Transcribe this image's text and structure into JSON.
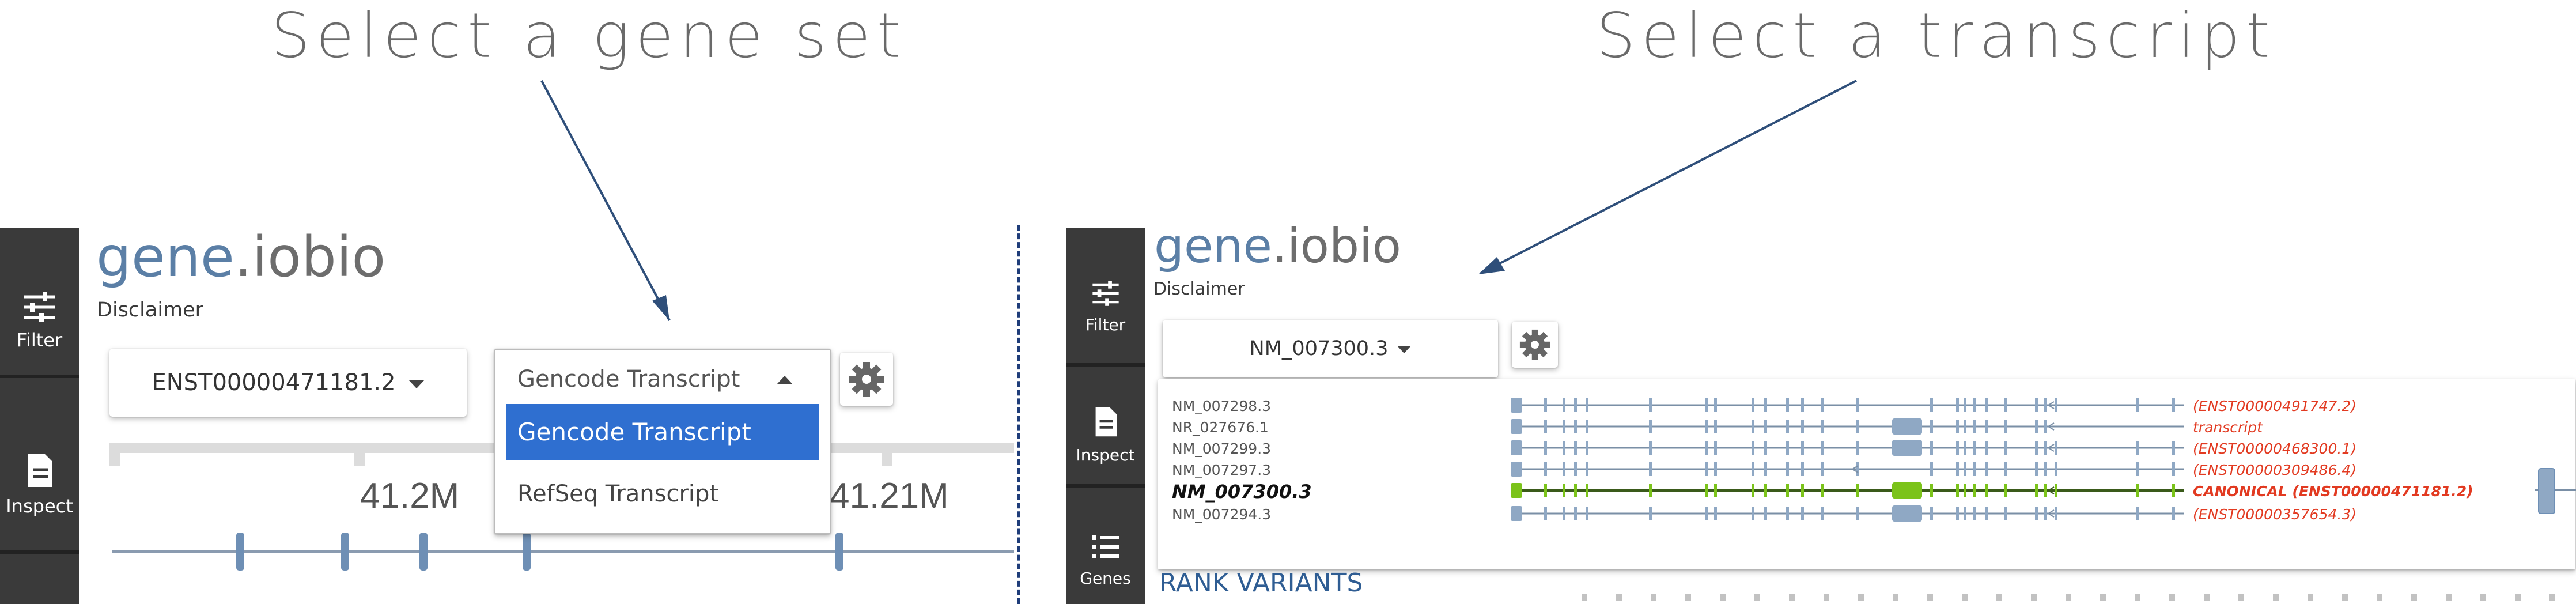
{
  "captions": {
    "left": "Select a gene set",
    "right": "Select a transcript"
  },
  "colors": {
    "sidebar": "#3a3a3a",
    "accent_blue": "#2f6fd0",
    "title_blue": "#5b7fa6",
    "canonical_green": "#7bc31a",
    "exon_blue": "#8fa8c4",
    "note_red": "#e23a21"
  },
  "left_app": {
    "title_gene": "gene",
    "title_rest": ".iobio",
    "disclaimer": "Disclaimer",
    "sidebar": [
      {
        "icon": "sliders-icon",
        "label": "Filter"
      },
      {
        "icon": "document-icon",
        "label": "Inspect"
      }
    ],
    "transcript_selector": "ENST00000471181.2",
    "gene_set_dropdown": {
      "selected": "Gencode Transcript",
      "options": [
        "Gencode Transcript",
        "RefSeq Transcript"
      ],
      "highlighted_index": 0
    },
    "settings_icon": "gear-icon",
    "ruler": {
      "labels": [
        "41.2M",
        "41.21M"
      ]
    }
  },
  "right_app": {
    "title_gene": "gene",
    "title_rest": ".iobio",
    "disclaimer": "Disclaimer",
    "sidebar": [
      {
        "icon": "sliders-icon",
        "label": "Filter"
      },
      {
        "icon": "document-icon",
        "label": "Inspect"
      },
      {
        "icon": "list-icon",
        "label": "Genes"
      }
    ],
    "transcript_selector": "NM_007300.3",
    "settings_icon": "gear-icon",
    "transcripts": [
      {
        "name": "NM_007298.3",
        "note": "(ENST00000491747.2)",
        "selected": false
      },
      {
        "name": "NR_027676.1",
        "note": "transcript",
        "selected": false
      },
      {
        "name": "NM_007299.3",
        "note": "(ENST00000468300.1)",
        "selected": false
      },
      {
        "name": "NM_007297.3",
        "note": "(ENST00000309486.4)",
        "selected": false
      },
      {
        "name": "NM_007300.3",
        "note": "CANONICAL (ENST00000471181.2)",
        "selected": true
      },
      {
        "name": "NM_007294.3",
        "note": "(ENST00000357654.3)",
        "selected": false
      }
    ],
    "section_heading": "RANK VARIANTS"
  }
}
